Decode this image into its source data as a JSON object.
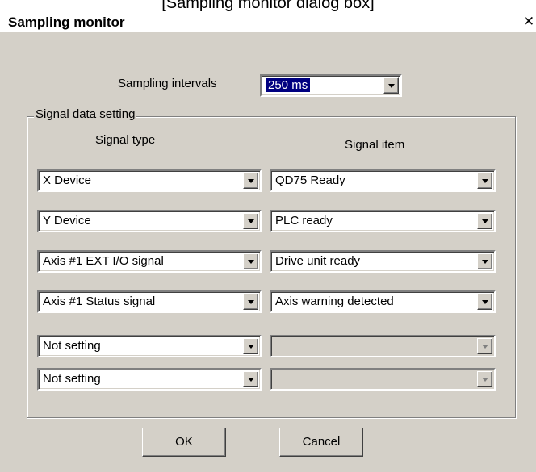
{
  "caption": "[Sampling monitor dialog box]",
  "window": {
    "title": "Sampling monitor",
    "close_glyph": "✕"
  },
  "sampling": {
    "label": "Sampling intervals",
    "value": "250 ms"
  },
  "signal_group": {
    "title": "Signal data setting",
    "col_type_header": "Signal type",
    "col_item_header": "Signal item",
    "rows": [
      {
        "type": "X Device",
        "item": "QD75 Ready",
        "item_enabled": true
      },
      {
        "type": "Y Device",
        "item": "PLC ready",
        "item_enabled": true
      },
      {
        "type": "Axis #1 EXT I/O signal",
        "item": "Drive unit ready",
        "item_enabled": true
      },
      {
        "type": "Axis #1 Status signal",
        "item": "Axis warning detected",
        "item_enabled": true
      },
      {
        "type": "Not setting",
        "item": "",
        "item_enabled": false
      },
      {
        "type": "Not setting",
        "item": "",
        "item_enabled": false
      }
    ]
  },
  "buttons": {
    "ok_label": "OK",
    "cancel_label": "Cancel"
  },
  "icons": {
    "dropdown": "chevron-down-icon",
    "close": "close-icon"
  },
  "colors": {
    "face": "#d4d0c8",
    "selection": "#000080"
  }
}
